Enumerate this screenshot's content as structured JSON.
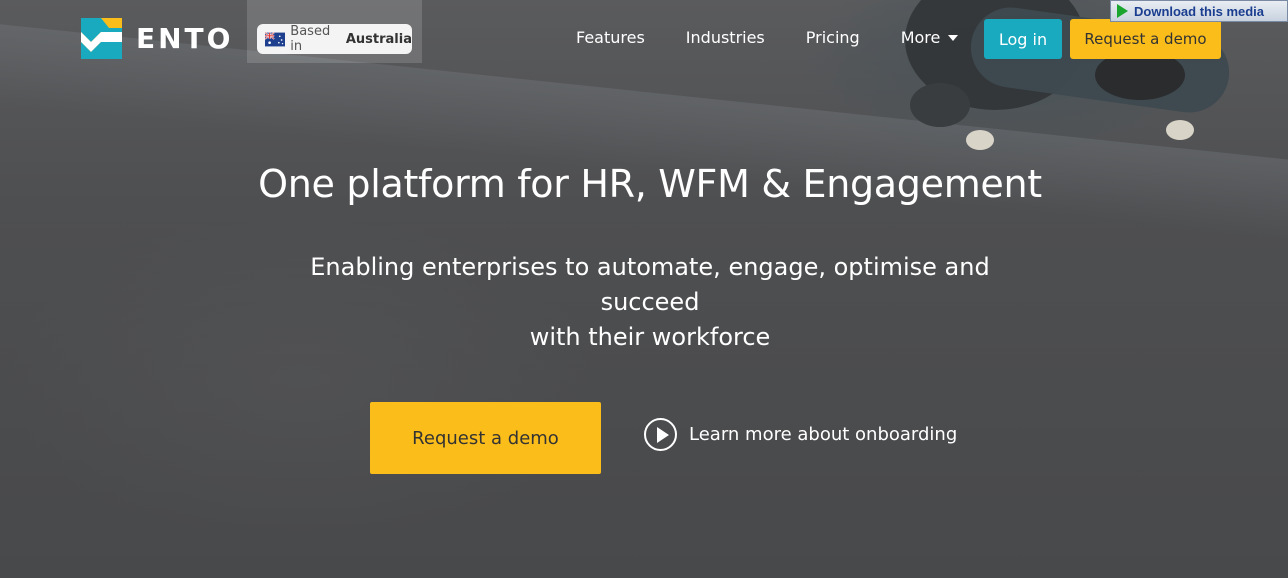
{
  "brand": {
    "name": "ENTO",
    "accent": "#19aabf",
    "cta": "#fbbd1a"
  },
  "badge": {
    "prefix": "Based in",
    "country": "Australia"
  },
  "nav": {
    "items": [
      "Features",
      "Industries",
      "Pricing",
      "More"
    ],
    "login": "Log in",
    "request_demo": "Request a demo"
  },
  "overlay": {
    "download_media": "Download this media"
  },
  "hero": {
    "title": "One platform for HR, WFM & Engagement",
    "subtitle_line1": "Enabling enterprises to automate, engage, optimise and succeed",
    "subtitle_line2": "with their workforce",
    "cta": "Request a demo",
    "learn_more": "Learn more about onboarding"
  }
}
